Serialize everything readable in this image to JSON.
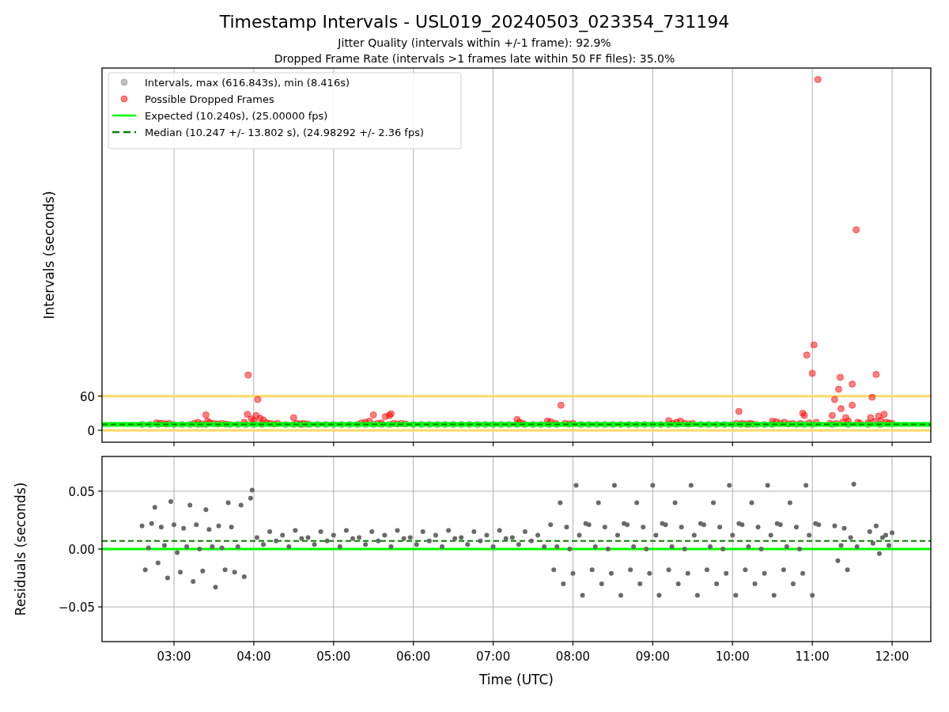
{
  "figure": {
    "title": "Timestamp Intervals - USL019_20240503_023354_731194",
    "subtitles": [
      "Jitter Quality (intervals within +/-1 frame): 92.9%",
      "Dropped Frame Rate (intervals >1 frames late within 50 FF files): 35.0%"
    ]
  },
  "panels": [
    {
      "chart_data": {
        "type": "scatter",
        "ylabel": "Intervals (seconds)",
        "grid": "x",
        "xlim": [
          2.098,
          12.485
        ],
        "ylim": [
          -21,
          636
        ],
        "yticks": [
          {
            "value": 0,
            "label": "0"
          },
          {
            "value": 60,
            "label": "60"
          }
        ],
        "series": [
          {
            "type": "scatter",
            "name": "Intervals, max (616.843s), min (8.416s)",
            "color": "#808080",
            "x": [
              2.6,
              2.7,
              2.8,
              3.0,
              3.1,
              3.2,
              3.3,
              3.4,
              3.7,
              3.8,
              3.9,
              4.0,
              4.1,
              4.4,
              4.5,
              4.6,
              4.7,
              4.8,
              4.9,
              5.0,
              5.1,
              5.2,
              5.3,
              5.4,
              5.5,
              5.6,
              5.7,
              6.0,
              6.1,
              6.2,
              6.3,
              6.4,
              6.5,
              6.6,
              6.7,
              6.8,
              6.9,
              7.0,
              7.1,
              7.2,
              7.3,
              7.4,
              7.5,
              7.6,
              7.7,
              7.8,
              8.1,
              8.2,
              8.3,
              8.4,
              8.5,
              8.6,
              8.7,
              8.8,
              8.9,
              9.0,
              9.1,
              9.2,
              9.3,
              9.6,
              9.7,
              9.8,
              9.9,
              10.0,
              10.1,
              10.2,
              10.3,
              10.4,
              10.5,
              10.8,
              10.9,
              11.0,
              11.25,
              11.45,
              11.7,
              11.85
            ],
            "values": [
              10.24,
              10.24,
              10.24,
              10.24,
              10.24,
              10.24,
              10.24,
              10.24,
              10.24,
              10.24,
              10.24,
              10.24,
              10.24,
              10.24,
              10.24,
              10.24,
              10.24,
              10.24,
              10.24,
              10.24,
              10.24,
              10.24,
              10.24,
              10.24,
              10.24,
              10.24,
              10.24,
              10.24,
              10.24,
              10.24,
              10.24,
              10.24,
              10.24,
              10.24,
              10.24,
              10.24,
              10.24,
              10.24,
              10.24,
              10.24,
              10.24,
              10.24,
              10.24,
              10.24,
              10.24,
              10.24,
              10.24,
              10.24,
              10.24,
              10.24,
              10.24,
              10.24,
              10.24,
              10.24,
              10.24,
              10.24,
              10.24,
              10.24,
              10.24,
              10.24,
              10.24,
              10.24,
              10.24,
              10.24,
              10.24,
              10.24,
              10.24,
              10.24,
              10.24,
              10.24,
              10.24,
              10.24,
              10.24,
              10.24,
              10.24,
              10.24
            ]
          },
          {
            "type": "scatter",
            "name": "Possible Dropped Frames",
            "color": "#ff0000",
            "x": [
              2.78,
              2.82,
              2.86,
              2.9,
              2.94,
              3.25,
              3.3,
              3.35,
              3.4,
              3.42,
              3.45,
              3.5,
              3.55,
              3.6,
              3.65,
              3.88,
              3.92,
              3.93,
              3.97,
              4.0,
              4.03,
              4.05,
              4.08,
              4.12,
              4.16,
              4.2,
              4.25,
              4.3,
              4.5,
              4.54,
              4.58,
              4.62,
              4.66,
              5.35,
              5.4,
              5.45,
              5.5,
              5.55,
              5.6,
              5.65,
              5.7,
              5.72,
              5.75,
              5.8,
              5.85,
              5.9,
              7.3,
              7.33,
              7.37,
              7.68,
              7.72,
              7.78,
              7.85,
              7.9,
              7.95,
              8.0,
              9.2,
              9.25,
              9.3,
              9.35,
              9.4,
              9.45,
              9.5,
              10.05,
              10.08,
              10.12,
              10.17,
              10.22,
              10.25,
              10.5,
              10.55,
              10.6,
              10.65,
              10.7,
              10.75,
              10.85,
              10.88,
              10.9,
              10.93,
              10.96,
              11.0,
              11.02,
              11.05,
              11.07,
              11.22,
              11.25,
              11.28,
              11.3,
              11.33,
              11.35,
              11.36,
              11.38,
              11.42,
              11.45,
              11.5,
              11.5,
              11.55,
              11.57,
              11.6,
              11.7,
              11.73,
              11.75,
              11.78,
              11.8,
              11.83,
              11.86,
              11.9,
              11.93,
              11.96,
              12.0
            ],
            "values": [
              13,
              12,
              12,
              11,
              12,
              12,
              14,
              11,
              27,
              16,
              13,
              12,
              11,
              12,
              11,
              14,
              28,
              97,
              20,
              17,
              26,
              54,
              21,
              18,
              13,
              12,
              11,
              12,
              22,
              12,
              11,
              12,
              11,
              13,
              14,
              16,
              27,
              12,
              13,
              24,
              26,
              29,
              12,
              11,
              12,
              11,
              19,
              14,
              12,
              16,
              15,
              12,
              44,
              12,
              11,
              12,
              17,
              12,
              14,
              16,
              12,
              11,
              12,
              12,
              33,
              12,
              11,
              12,
              11,
              16,
              15,
              12,
              14,
              11,
              12,
              12,
              30,
              26,
              132,
              13,
              100,
              150,
              14,
              616,
              12,
              26,
              54,
              12,
              72,
              93,
              38,
              14,
              22,
              16,
              81,
              44,
              352,
              14,
              12,
              13,
              22,
              58,
              15,
              98,
              25,
              17,
              28,
              14,
              12,
              12
            ]
          },
          {
            "type": "line",
            "color": "#ffd966",
            "x": [
              2.098,
              12.485
            ],
            "values": [
              60,
              60
            ]
          },
          {
            "type": "line",
            "color": "#ffd966",
            "x": [
              2.098,
              12.485
            ],
            "values": [
              0,
              0
            ]
          },
          {
            "type": "line",
            "name": "Expected (10.240s), (25.00000 fps)",
            "color": "#00ff00",
            "x": [
              2.098,
              12.485
            ],
            "values": [
              10.24,
              10.24
            ]
          },
          {
            "type": "line",
            "line_style": "dashed",
            "name": "Median (10.247 +/- 13.802 s), (24.98292 +/- 2.36 fps)",
            "color": "#008000",
            "x": [
              2.098,
              12.485
            ],
            "values": [
              10.247,
              10.247
            ]
          }
        ],
        "legend": true
      }
    },
    {
      "chart_data": {
        "type": "scatter",
        "xlabel": "Time (UTC)",
        "ylabel": "Residuals (seconds)",
        "grid": "both",
        "xlim": [
          2.098,
          12.485
        ],
        "ylim": [
          -0.08,
          0.08
        ],
        "xticks": [
          {
            "value": 3,
            "label": "03:00"
          },
          {
            "value": 4,
            "label": "04:00"
          },
          {
            "value": 5,
            "label": "05:00"
          },
          {
            "value": 6,
            "label": "06:00"
          },
          {
            "value": 7,
            "label": "07:00"
          },
          {
            "value": 8,
            "label": "08:00"
          },
          {
            "value": 9,
            "label": "09:00"
          },
          {
            "value": 10,
            "label": "10:00"
          },
          {
            "value": 11,
            "label": "11:00"
          },
          {
            "value": 12,
            "label": "12:00"
          }
        ],
        "yticks": [
          {
            "value": -0.05,
            "label": "−0.05"
          },
          {
            "value": 0,
            "label": "0.00"
          },
          {
            "value": 0.05,
            "label": "0.05"
          }
        ],
        "series": [
          {
            "type": "scatter",
            "color": "#696969",
            "x": [
              2.6,
              2.64,
              2.68,
              2.72,
              2.76,
              2.8,
              2.84,
              2.88,
              2.92,
              2.96,
              3.0,
              3.04,
              3.08,
              3.12,
              3.16,
              3.2,
              3.24,
              3.28,
              3.32,
              3.36,
              3.4,
              3.44,
              3.48,
              3.52,
              3.56,
              3.6,
              3.64,
              3.68,
              3.72,
              3.76,
              3.8,
              3.84,
              3.88,
              3.96,
              3.98,
              4.04,
              4.12,
              4.2,
              4.28,
              4.36,
              4.44,
              4.52,
              4.6,
              4.68,
              4.76,
              4.84,
              4.92,
              5.0,
              5.08,
              5.16,
              5.24,
              5.32,
              5.4,
              5.48,
              5.56,
              5.64,
              5.72,
              5.8,
              5.88,
              5.96,
              6.04,
              6.12,
              6.2,
              6.28,
              6.36,
              6.44,
              6.52,
              6.6,
              6.68,
              6.76,
              6.84,
              6.92,
              7.0,
              7.08,
              7.16,
              7.24,
              7.32,
              7.4,
              7.48,
              7.56,
              7.64,
              7.72,
              7.76,
              7.8,
              7.84,
              7.88,
              7.92,
              7.96,
              8.0,
              8.04,
              8.08,
              8.12,
              8.16,
              8.2,
              8.24,
              8.28,
              8.32,
              8.36,
              8.4,
              8.44,
              8.48,
              8.52,
              8.56,
              8.6,
              8.64,
              8.68,
              8.72,
              8.76,
              8.8,
              8.84,
              8.88,
              8.92,
              8.96,
              9.0,
              9.04,
              9.08,
              9.12,
              9.16,
              9.2,
              9.24,
              9.28,
              9.32,
              9.36,
              9.4,
              9.44,
              9.48,
              9.52,
              9.56,
              9.6,
              9.64,
              9.68,
              9.72,
              9.76,
              9.8,
              9.84,
              9.88,
              9.92,
              9.96,
              10.0,
              10.04,
              10.08,
              10.12,
              10.16,
              10.2,
              10.24,
              10.28,
              10.32,
              10.36,
              10.4,
              10.44,
              10.48,
              10.52,
              10.56,
              10.6,
              10.64,
              10.68,
              10.72,
              10.76,
              10.8,
              10.84,
              10.88,
              10.92,
              10.96,
              11.0,
              11.04,
              11.08,
              11.28,
              11.32,
              11.36,
              11.4,
              11.44,
              11.48,
              11.52,
              11.56,
              11.72,
              11.76,
              11.8,
              11.84,
              11.88,
              11.92,
              11.96,
              12.0
            ],
            "values": [
              0.02,
              -0.018,
              0.001,
              0.022,
              0.036,
              -0.012,
              0.019,
              0.003,
              -0.025,
              0.041,
              0.021,
              -0.003,
              -0.02,
              0.018,
              0.002,
              0.038,
              -0.028,
              0.021,
              0.0,
              -0.019,
              0.034,
              0.017,
              0.002,
              -0.033,
              0.02,
              0.001,
              -0.018,
              0.04,
              0.019,
              -0.02,
              0.002,
              0.038,
              -0.024,
              0.044,
              0.051,
              0.01,
              0.004,
              0.015,
              0.007,
              0.012,
              0.002,
              0.016,
              0.009,
              0.01,
              0.004,
              0.015,
              0.007,
              0.012,
              0.002,
              0.016,
              0.009,
              0.01,
              0.004,
              0.015,
              0.007,
              0.012,
              0.002,
              0.016,
              0.009,
              0.01,
              0.004,
              0.015,
              0.007,
              0.012,
              0.002,
              0.016,
              0.009,
              0.01,
              0.004,
              0.015,
              0.007,
              0.012,
              0.002,
              0.016,
              0.009,
              0.01,
              0.004,
              0.015,
              0.007,
              0.012,
              0.002,
              0.021,
              -0.018,
              0.002,
              0.04,
              -0.03,
              0.019,
              0.0,
              -0.021,
              0.055,
              0.012,
              -0.04,
              0.022,
              0.021,
              -0.018,
              0.002,
              0.04,
              -0.03,
              0.019,
              0.0,
              -0.021,
              0.055,
              0.012,
              -0.04,
              0.022,
              0.021,
              -0.018,
              0.002,
              0.04,
              -0.03,
              0.019,
              0.0,
              -0.021,
              0.055,
              0.012,
              -0.04,
              0.022,
              0.021,
              -0.018,
              0.002,
              0.04,
              -0.03,
              0.019,
              0.0,
              -0.021,
              0.055,
              0.012,
              -0.04,
              0.022,
              0.021,
              -0.018,
              0.002,
              0.04,
              -0.03,
              0.019,
              0.0,
              -0.021,
              0.055,
              0.012,
              -0.04,
              0.022,
              0.021,
              -0.018,
              0.002,
              0.04,
              -0.03,
              0.019,
              0.0,
              -0.021,
              0.055,
              0.012,
              -0.04,
              0.022,
              0.021,
              -0.018,
              0.002,
              0.04,
              -0.03,
              0.019,
              0.0,
              -0.021,
              0.055,
              0.012,
              -0.04,
              0.022,
              0.021,
              0.02,
              -0.01,
              0.003,
              0.018,
              -0.018,
              0.01,
              0.056,
              0.002,
              0.015,
              0.005,
              0.02,
              -0.004,
              0.01,
              0.012,
              0.003,
              0.014
            ]
          },
          {
            "type": "line",
            "color": "#00ff00",
            "x": [
              2.098,
              12.485
            ],
            "values": [
              0,
              0
            ]
          },
          {
            "type": "line",
            "line_style": "dashed",
            "color": "#008000",
            "x": [
              2.098,
              12.485
            ],
            "values": [
              0.007,
              0.007
            ]
          }
        ]
      }
    }
  ]
}
